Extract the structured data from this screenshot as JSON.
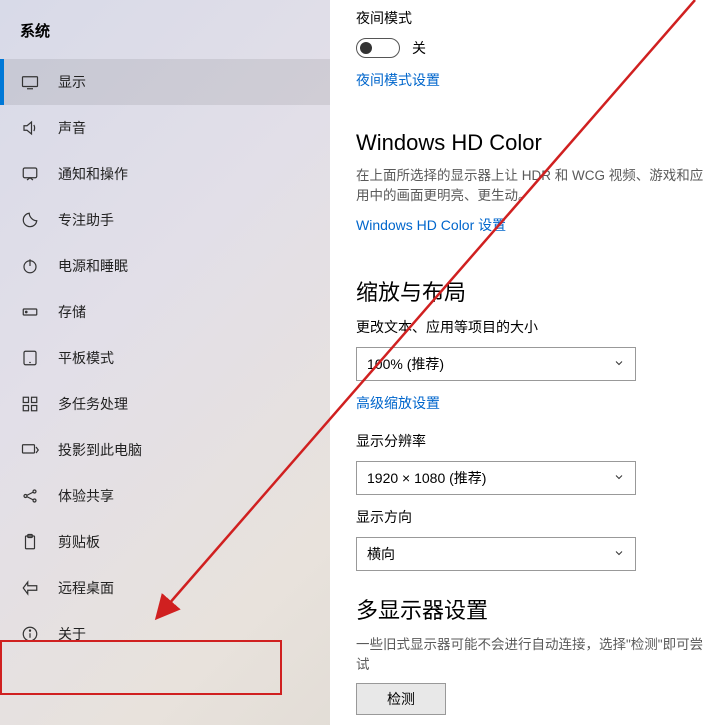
{
  "sidebar": {
    "header": "系统",
    "items": [
      {
        "label": "显示",
        "icon": "display"
      },
      {
        "label": "声音",
        "icon": "sound"
      },
      {
        "label": "通知和操作",
        "icon": "notifications"
      },
      {
        "label": "专注助手",
        "icon": "focus"
      },
      {
        "label": "电源和睡眠",
        "icon": "power"
      },
      {
        "label": "存储",
        "icon": "storage"
      },
      {
        "label": "平板模式",
        "icon": "tablet"
      },
      {
        "label": "多任务处理",
        "icon": "multitask"
      },
      {
        "label": "投影到此电脑",
        "icon": "project"
      },
      {
        "label": "体验共享",
        "icon": "share"
      },
      {
        "label": "剪贴板",
        "icon": "clipboard"
      },
      {
        "label": "远程桌面",
        "icon": "remote"
      },
      {
        "label": "关于",
        "icon": "about"
      }
    ]
  },
  "content": {
    "night_mode_label": "夜间模式",
    "night_mode_state": "关",
    "night_mode_link": "夜间模式设置",
    "hdcolor_title": "Windows HD Color",
    "hdcolor_desc": "在上面所选择的显示器上让 HDR 和 WCG 视频、游戏和应用中的画面更明亮、更生动。",
    "hdcolor_link": "Windows HD Color 设置",
    "scale_title": "缩放与布局",
    "scale_label": "更改文本、应用等项目的大小",
    "scale_value": "100% (推荐)",
    "scale_link": "高级缩放设置",
    "resolution_label": "显示分辨率",
    "resolution_value": "1920 × 1080 (推荐)",
    "orientation_label": "显示方向",
    "orientation_value": "横向",
    "multi_title": "多显示器设置",
    "multi_desc": "一些旧式显示器可能不会进行自动连接，选择\"检测\"即可尝试",
    "detect_button": "检测"
  }
}
